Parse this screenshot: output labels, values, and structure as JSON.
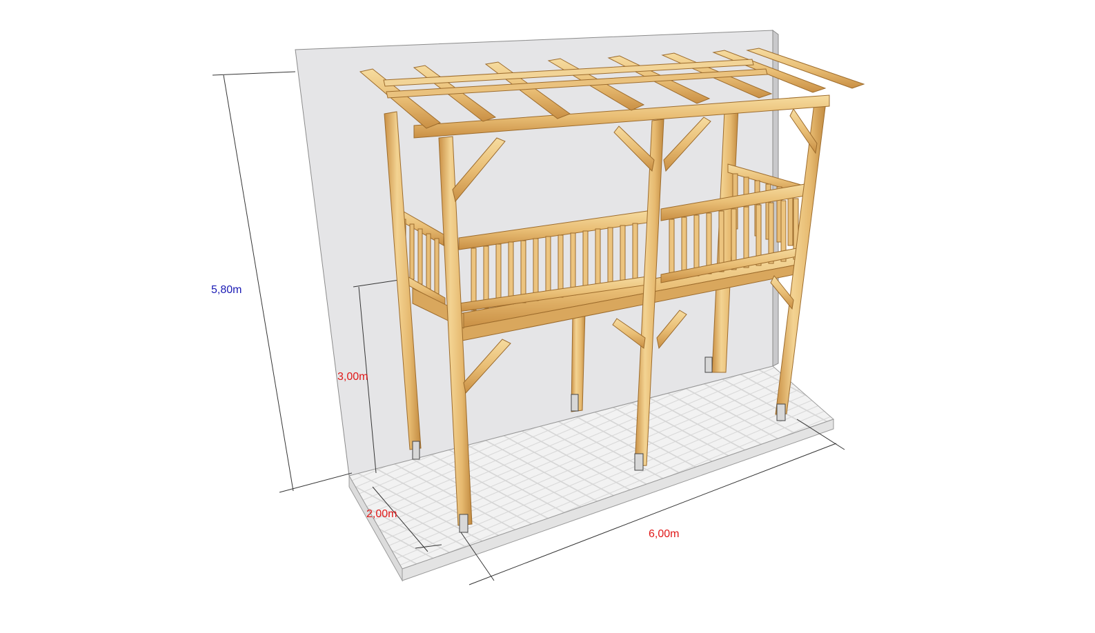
{
  "dimensions": {
    "total_height": "5,80m",
    "deck_height": "3,00m",
    "depth": "2,00m",
    "length": "6,00m"
  },
  "colors": {
    "total_height_label": "#1a1ab4",
    "measure_label": "#e01818",
    "wall": "#e6e6e8",
    "wood_light": "#f0cd8c",
    "wood_mid": "#e2b36a",
    "wood_dark": "#c78f45",
    "floor": "#efefef",
    "dimension_line": "#333333"
  }
}
